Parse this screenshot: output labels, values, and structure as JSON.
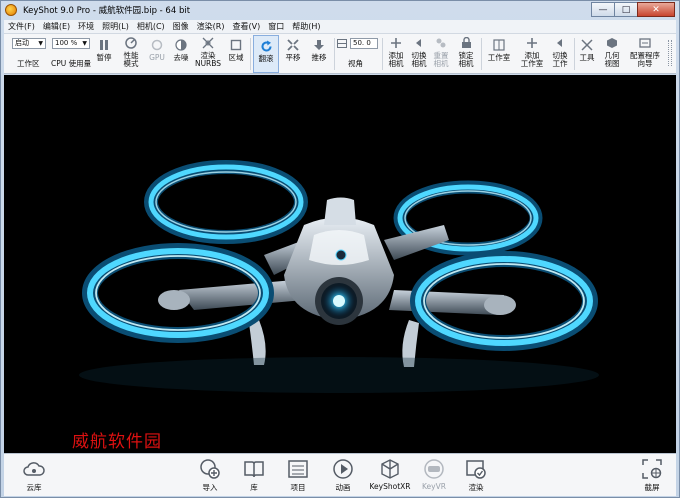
{
  "window": {
    "title": "KeyShot 9.0 Pro  - 威航软件园.bip  - 64 bit",
    "controls": {
      "minimize": "—",
      "maximize": "□",
      "close": "✕"
    }
  },
  "menu": [
    "文件(F)",
    "编辑(E)",
    "环境",
    "照明(L)",
    "相机(C)",
    "图像",
    "渲染(R)",
    "查看(V)",
    "窗口",
    "帮助(H)"
  ],
  "toolbar": {
    "workspace_select": "启动",
    "workspace_label": "工作区",
    "cpu_select": "100 %",
    "cpu_label": "CPU 使用量",
    "pause": "暂停",
    "perf_line1": "性能",
    "perf_line2": "模式",
    "gpu": "GPU",
    "denoise": "去噪",
    "nurbs_line1": "渲染",
    "nurbs_line2": "NURBS",
    "region": "区域",
    "tumble": "翻滚",
    "pan": "平移",
    "dolly": "推移",
    "fov_value": "50. 0",
    "fov_label": "视角",
    "add_cam_line1": "添加",
    "add_cam_line2": "相机",
    "switch_cam_line1": "切换",
    "switch_cam_line2": "相机",
    "reset_cam_line1": "重置",
    "reset_cam_line2": "相机",
    "lock_cam_line1": "锁定",
    "lock_cam_line2": "相机",
    "studio": "工作室",
    "add_studio_line1": "添加",
    "add_studio_line2": "工作室",
    "switch_work_line1": "切换",
    "switch_work_line2": "工作",
    "tools": "工具",
    "geo_line1": "几何",
    "geo_line2": "视图",
    "wizard_line1": "配置程序",
    "wizard_line2": "向导"
  },
  "viewport": {
    "watermark": "威航软件园",
    "accent": "#2ec8ff",
    "background": "#000000"
  },
  "bottom": {
    "cloud": "云库",
    "import": "导入",
    "library": "库",
    "project": "项目",
    "animation": "动画",
    "keyshotxr": "KeyShotXR",
    "keyvr": "KeyVR",
    "render": "渲染",
    "screenshot": "截屏"
  }
}
